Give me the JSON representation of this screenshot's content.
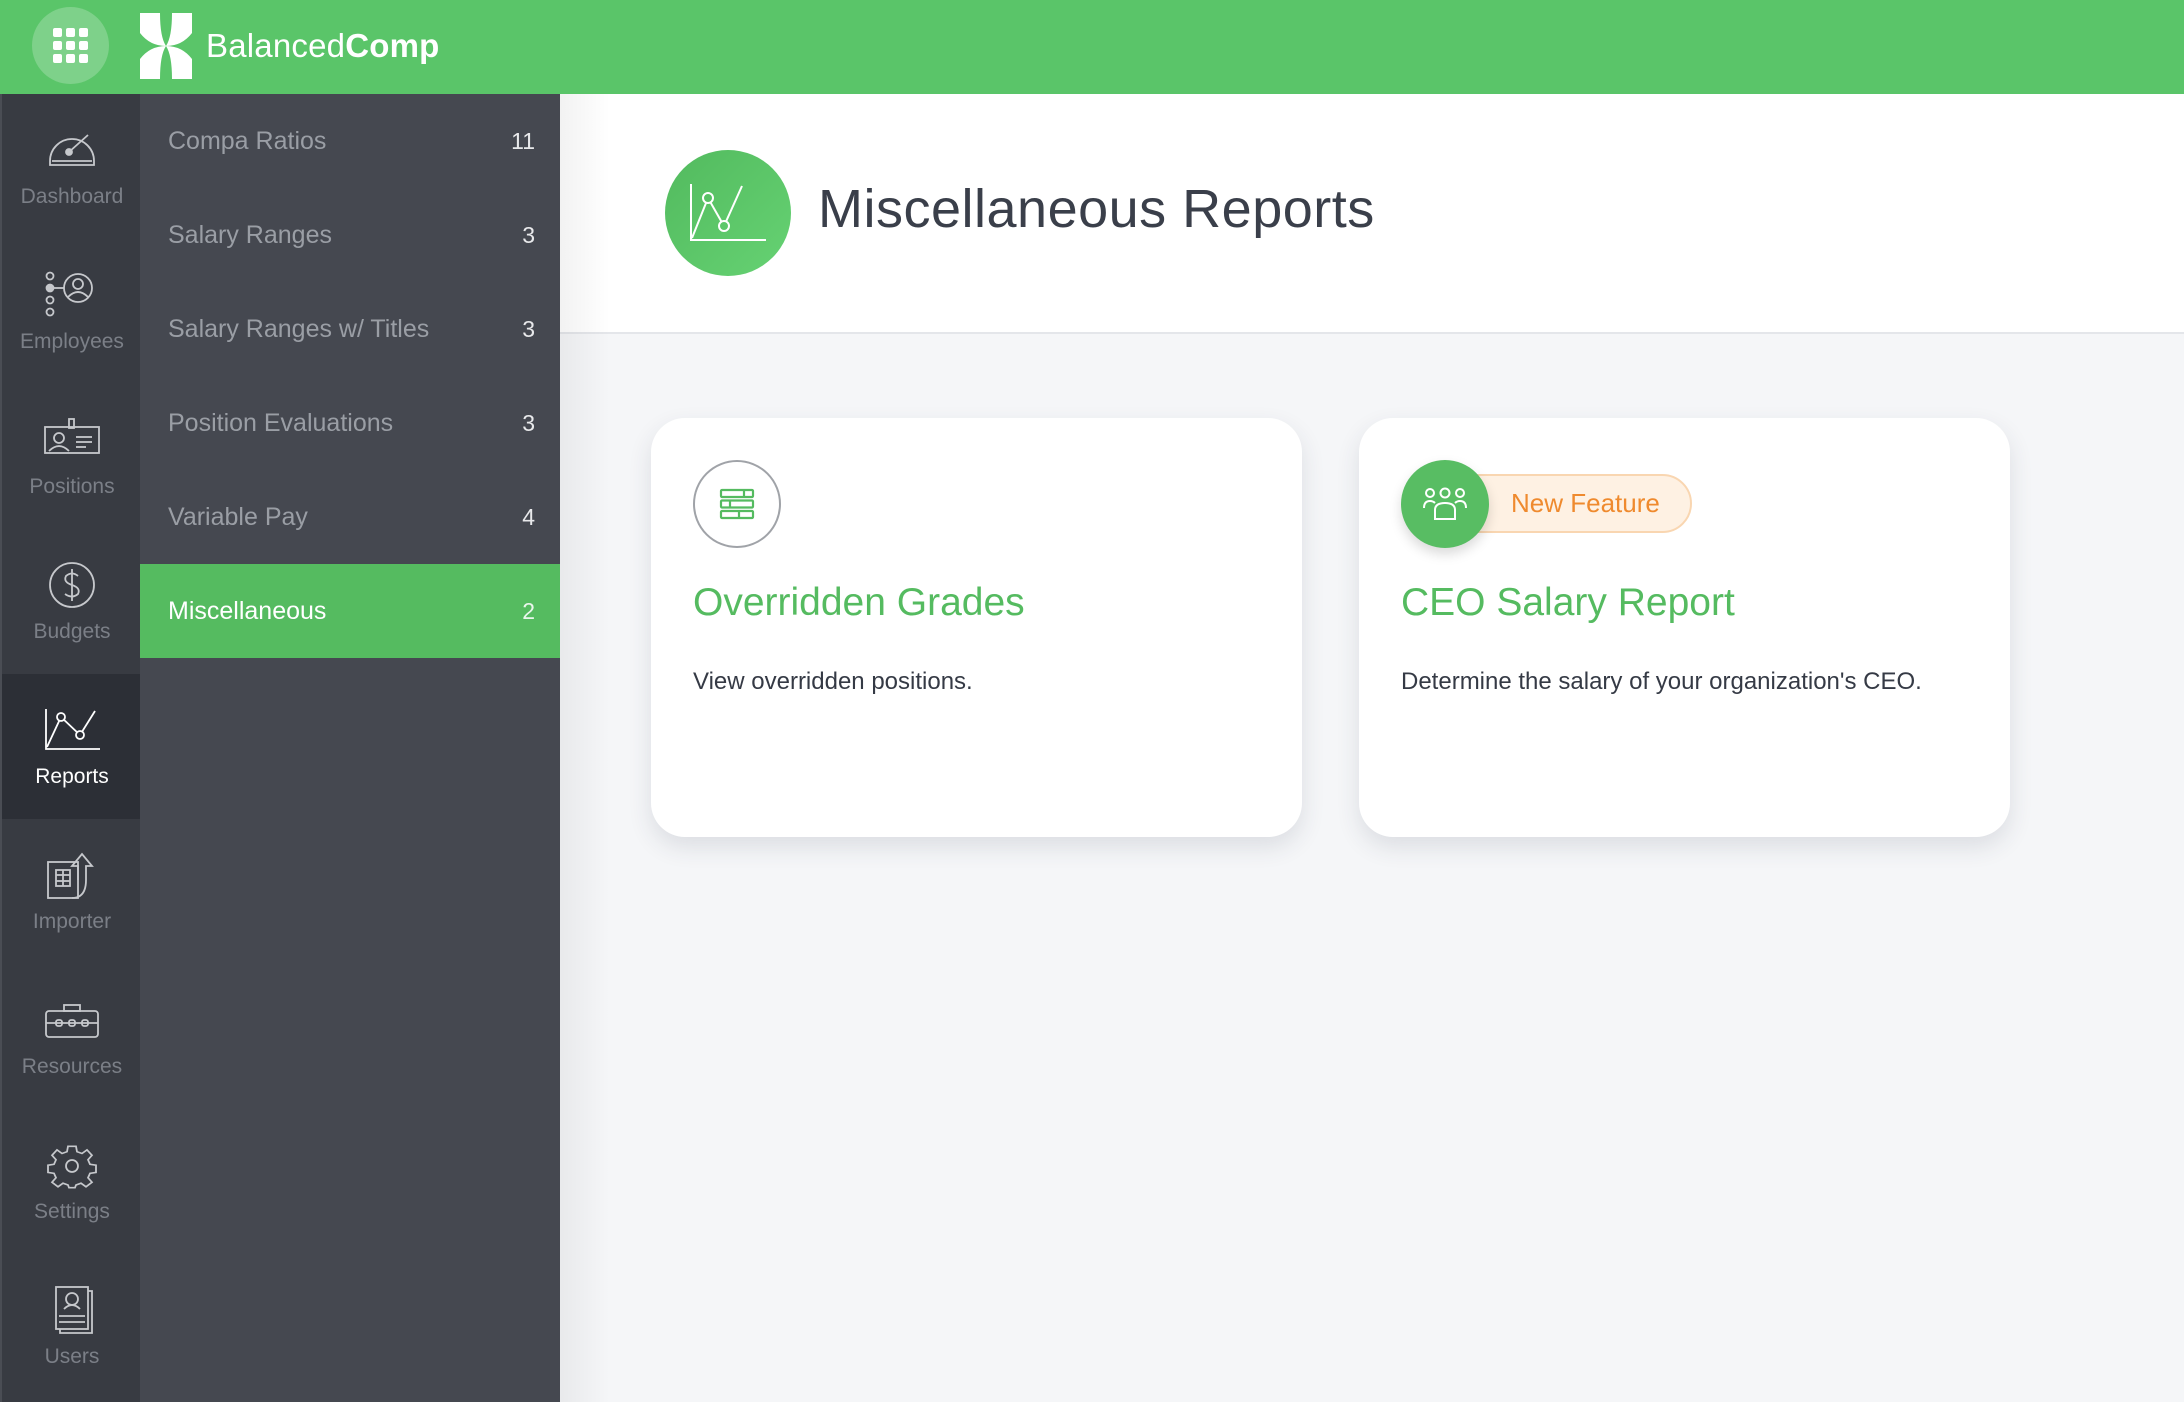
{
  "app": {
    "brand_light": "Balanced",
    "brand_bold": "Comp",
    "apps_menu_icon": "grid-icon",
    "accent_color": "#5ac569"
  },
  "rail": {
    "items": [
      {
        "label": "Dashboard",
        "icon": "speedometer-icon",
        "active": false
      },
      {
        "label": "Employees",
        "icon": "org-person-icon",
        "active": false
      },
      {
        "label": "Positions",
        "icon": "id-badge-icon",
        "active": false
      },
      {
        "label": "Budgets",
        "icon": "dollar-circle-icon",
        "active": false
      },
      {
        "label": "Reports",
        "icon": "line-chart-icon",
        "active": true
      },
      {
        "label": "Importer",
        "icon": "spreadsheet-upload-icon",
        "active": false
      },
      {
        "label": "Resources",
        "icon": "toolbox-icon",
        "active": false
      },
      {
        "label": "Settings",
        "icon": "gear-icon",
        "active": false
      },
      {
        "label": "Users",
        "icon": "user-card-icon",
        "active": false
      }
    ]
  },
  "subnav": {
    "items": [
      {
        "label": "Compa Ratios",
        "count": "11",
        "active": false
      },
      {
        "label": "Salary Ranges",
        "count": "3",
        "active": false
      },
      {
        "label": "Salary Ranges w/ Titles",
        "count": "3",
        "active": false
      },
      {
        "label": "Position Evaluations",
        "count": "3",
        "active": false
      },
      {
        "label": "Variable Pay",
        "count": "4",
        "active": false
      },
      {
        "label": "Miscellaneous",
        "count": "2",
        "active": true
      }
    ]
  },
  "page": {
    "title": "Miscellaneous Reports",
    "icon": "line-chart-icon"
  },
  "cards": [
    {
      "title": "Overridden Grades",
      "description": "View overridden positions.",
      "icon": "table-rows-icon",
      "badge": null
    },
    {
      "title": "CEO Salary Report",
      "description": "Determine the salary of your organization's CEO.",
      "icon": "group-icon",
      "badge": "New Feature",
      "badge_color": "#ef8a2e"
    }
  ]
}
